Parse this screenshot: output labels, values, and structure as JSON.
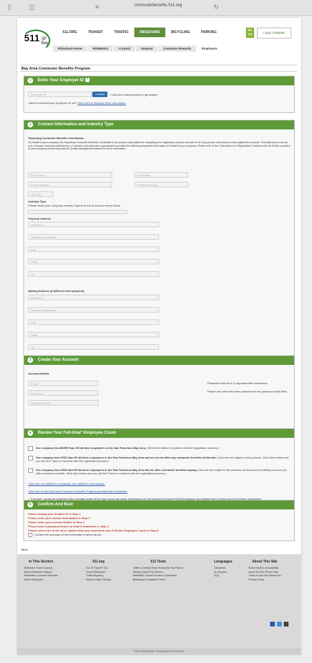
{
  "browser": {
    "url": "commuterbenefits.511.org"
  },
  "logo": {
    "number": "511",
    "region": "SF Bay"
  },
  "nav_primary": [
    {
      "label": "511.ORG",
      "active": false
    },
    {
      "label": "TRANSIT",
      "active": false
    },
    {
      "label": "TRAFFIC",
      "active": false
    },
    {
      "label": "RIDESHARE",
      "active": true
    },
    {
      "label": "BICYCLING",
      "active": false
    },
    {
      "label": "PARKING",
      "active": false
    }
  ],
  "my511": {
    "line1": "MY",
    "line2": "511"
  },
  "login_text": "Login | Register",
  "nav_secondary": [
    {
      "label": "Rideshare Home",
      "active": false
    },
    {
      "label": "RideMatch",
      "active": false
    },
    {
      "label": "Carpool",
      "active": false
    },
    {
      "label": "Vanpool",
      "active": false
    },
    {
      "label": "Commute Rewards",
      "active": false
    },
    {
      "label": "Employers",
      "active": true
    }
  ],
  "page_title": "Bay Area Commuter Benefits Program",
  "step1": {
    "num": "1",
    "title": "Enter Your Employer ID",
    "help": "?",
    "employer_id_placeholder": "Employer ID",
    "lookup_label": "Lookup",
    "lookup_hint": "« Click the Lookup button to get started",
    "no_id_prefix": "Haven't received your Employer ID yet?",
    "no_id_link": "Click Here to Request More Information"
  },
  "step2": {
    "num": "2",
    "title": "Contact Information and Industry Type",
    "coordinator_heading": "Reporting Commuter Benefits Coordinator",
    "coordinator_text": "On behalf of your company, the Reporting Commuter Benefits Coordinator is the person responsible for completing the registration process and will be the only person with access to this registration process. This staff person can be you, a human resources staff person, or whoever you determine appropriate to provide the following requested information on behalf of your company. Please refer to the \"Instructions for Registration\" included with the Notice provided to your company by the Bay Area Air Quality Management District for more information.",
    "first_name": "First Name",
    "last_name": "Last Name",
    "phone": "Phone Number",
    "phone_ext": "Phone Extension",
    "job_title": "Job Title",
    "industry_heading": "Industry Type",
    "industry_text": "Please select your company Industry Type from the drop-down menu below",
    "physical_heading": "Physical Address",
    "physical_fields": [
      "Address 1",
      "Address 2 (optional)",
      "City",
      "State",
      "Zip"
    ],
    "mailing_heading": "Mailing Address (if different from physical)",
    "mailing_fields": [
      "Address 1",
      "Address 2 (optional)",
      "City",
      "State",
      "Zip"
    ]
  },
  "step3": {
    "num": "3",
    "title": "Create Your Account",
    "details_heading": "Account Details",
    "email": "Email",
    "password": "Password",
    "password_verify": "Password Verify",
    "pw_rule": "Password must be 6-12 alphanumeric characters.",
    "pw_rule2": "Please also enter the same password in the password verify field."
  },
  "step4": {
    "num": "4",
    "title": "Review Your Full-time* Employee Count",
    "opt1_bold": "Our company has MORE than 50 full-time employees in the San Francisco Bay Area.",
    "opt1_it": "(Click Next below to continue with the registration process.)",
    "opt2_bold": "Our company has LESS than 50 full-time employees in the San Francisco Bay Area and we do not offer any commuter benefits at this time.",
    "opt2_it": "(You are not subject to this process. Click Next below and you will NOT have to continue with the registration process.)",
    "opt3_bold": "Our company has LESS than 50 full-time employees in the San Francisco Bay Area but we offer commuter benefits anyway.",
    "opt3_it": "(You are not subject to this process but thank you for letting us know you offer commuter benefits. Click Next below and you will NOT have to continue with the registration process.)",
    "link1": "Click here for definition of employer and definition of employee.",
    "link2": "Click here to see Bay Area Commuter Benefits Program jurisdictional boundaries.",
    "footnote": "* \"Full-time\" means an employee who normally works 30 or more hours per week. Employers are not required to include Field Employees (as defined here) in their count of full-time employees."
  },
  "step5": {
    "num": "5",
    "title": "Confirm And Next",
    "errors": [
      "Please lookup your location ID in Step 1",
      "Please enter your contact information in Step 2",
      "Please enter your account details in Step 3",
      "Please enter a password that is at least 6 characters in Step 3",
      "Please select one of the three options that best represents your Full-time Employee Count in Step 4"
    ],
    "confirm": "I confirm the accuracy of the information entered above.",
    "next_label": "Next"
  },
  "next_text": "Next",
  "footer": {
    "section_title": "In This Section",
    "section_items": [
      "Rideshare Home  Carpool",
      "About Rideshare  Vanpool",
      "RideMatch  Commute Rewards",
      "Media  Employers"
    ],
    "org_title": "511.org",
    "org_items": [
      "511 SF Bay  MY 511",
      "Transit  Rideshare",
      "Traffic  Bicycling",
      "Mobile & Apps  Parking"
    ],
    "tools_title": "511 Tools",
    "tools_items": [
      "Traffic & Driving Times  Enhanced Trip Planner",
      "Parking  Transit Trip Planner",
      "RideMatch Service  Routes & Schedules",
      "BikeMapper  Departure Times"
    ],
    "lang_title": "Languages",
    "lang_items": [
      "Disclaimer",
      "En Español",
      "中文"
    ],
    "about_title": "About This Site",
    "about_items": [
      "Brand Toolbox  Accessibility",
      "About 511  511 Phone Help",
      "Terms of Use  Dev Resources",
      "Privacy Policy"
    ],
    "copyright": "©2016 Metropolitan Transportation Commission"
  },
  "colors": {
    "green": "#5e9b38",
    "nav_active": "#5f8f3e",
    "button_blue": "#2f6db0",
    "error_red": "#c0392b"
  }
}
